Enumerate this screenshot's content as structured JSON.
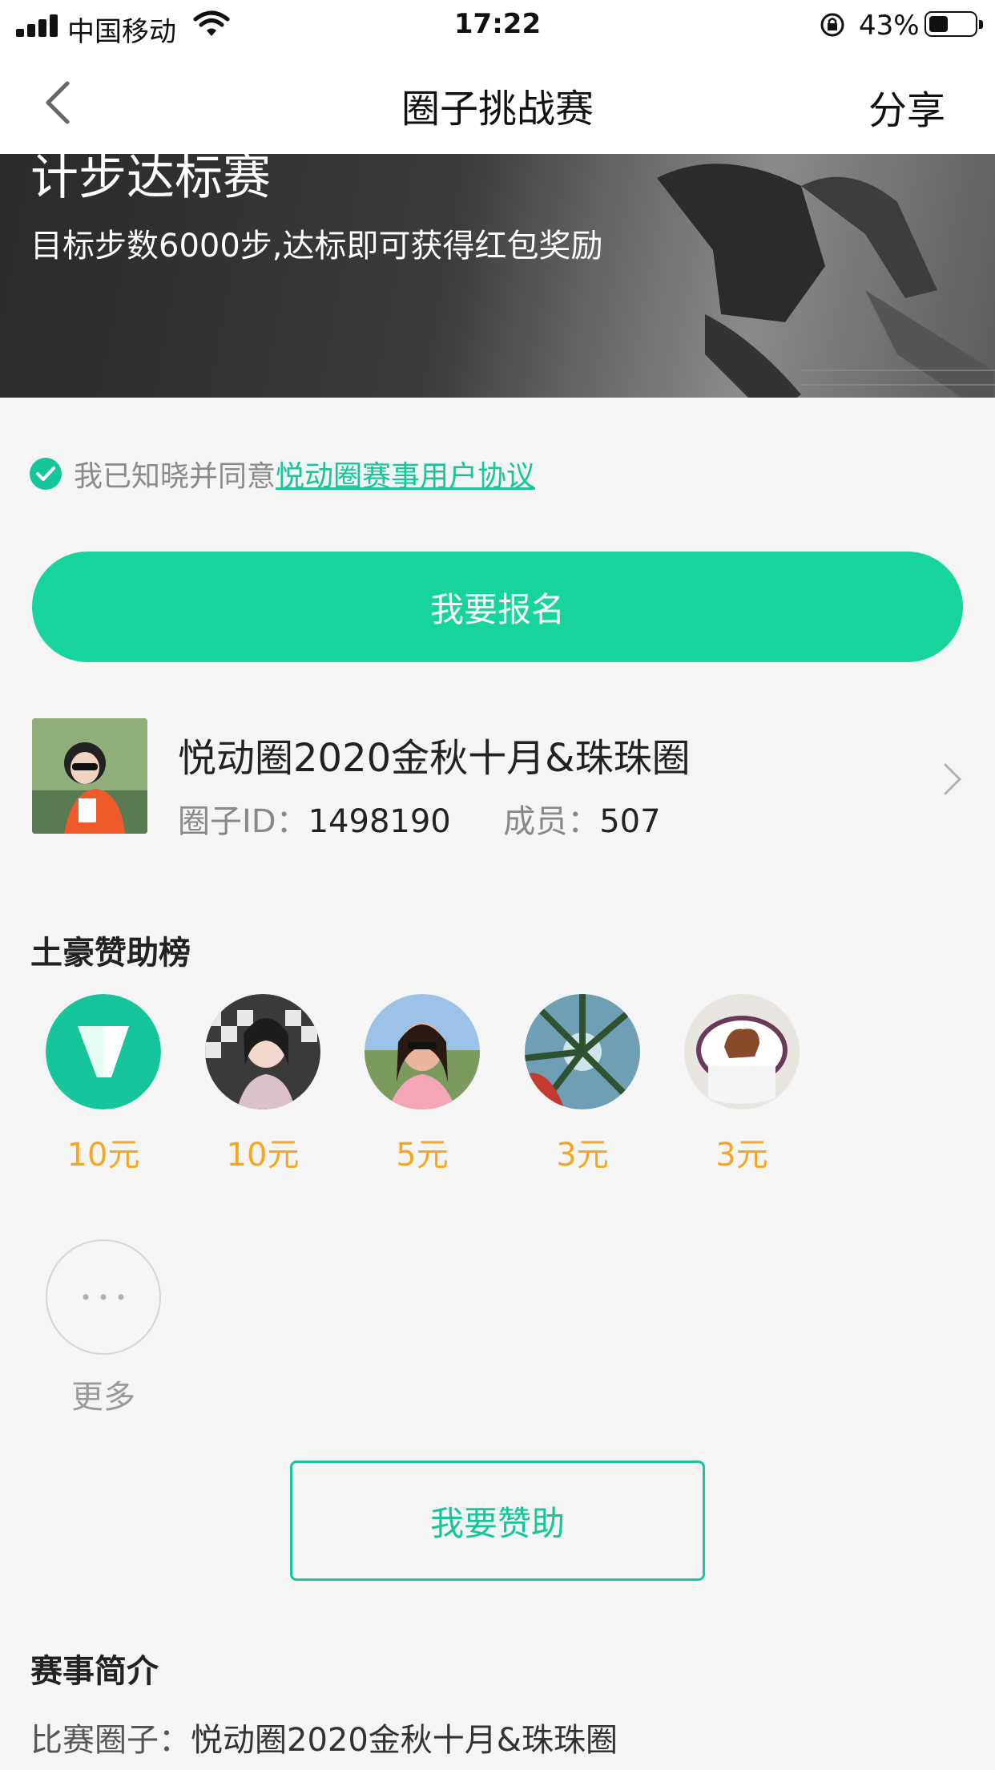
{
  "status_bar": {
    "carrier": "中国移动",
    "time": "17:22",
    "battery_percent": "43%",
    "battery_level": 0.43
  },
  "nav": {
    "title": "圈子挑战赛",
    "share_label": "分享"
  },
  "banner": {
    "title": "计步达标赛",
    "subtitle": "目标步数6000步,达标即可获得红包奖励"
  },
  "agreement": {
    "text": "我已知晓并同意",
    "link": "悦动圈赛事用户协议",
    "checked": true
  },
  "signup_button": "我要报名",
  "circle": {
    "name": "悦动圈2020金秋十月&珠珠圈",
    "id_label": "圈子ID：",
    "id_value": "1498190",
    "members_label": "成员：",
    "members_value": "507"
  },
  "sponsors": {
    "title": "土豪赞助榜",
    "items": [
      {
        "amount": "10元",
        "avatar": "brand-logo"
      },
      {
        "amount": "10元",
        "avatar": "user-photo"
      },
      {
        "amount": "5元",
        "avatar": "user-photo"
      },
      {
        "amount": "3元",
        "avatar": "user-photo"
      },
      {
        "amount": "3元",
        "avatar": "user-photo"
      }
    ],
    "more_label": "更多",
    "button": "我要赞助"
  },
  "intro": {
    "title": "赛事简介",
    "circle_label": "比赛圈子：",
    "circle_value": "悦动圈2020金秋十月&珠珠圈"
  },
  "colors": {
    "accent": "#17d49c",
    "amount": "#f5a623"
  }
}
